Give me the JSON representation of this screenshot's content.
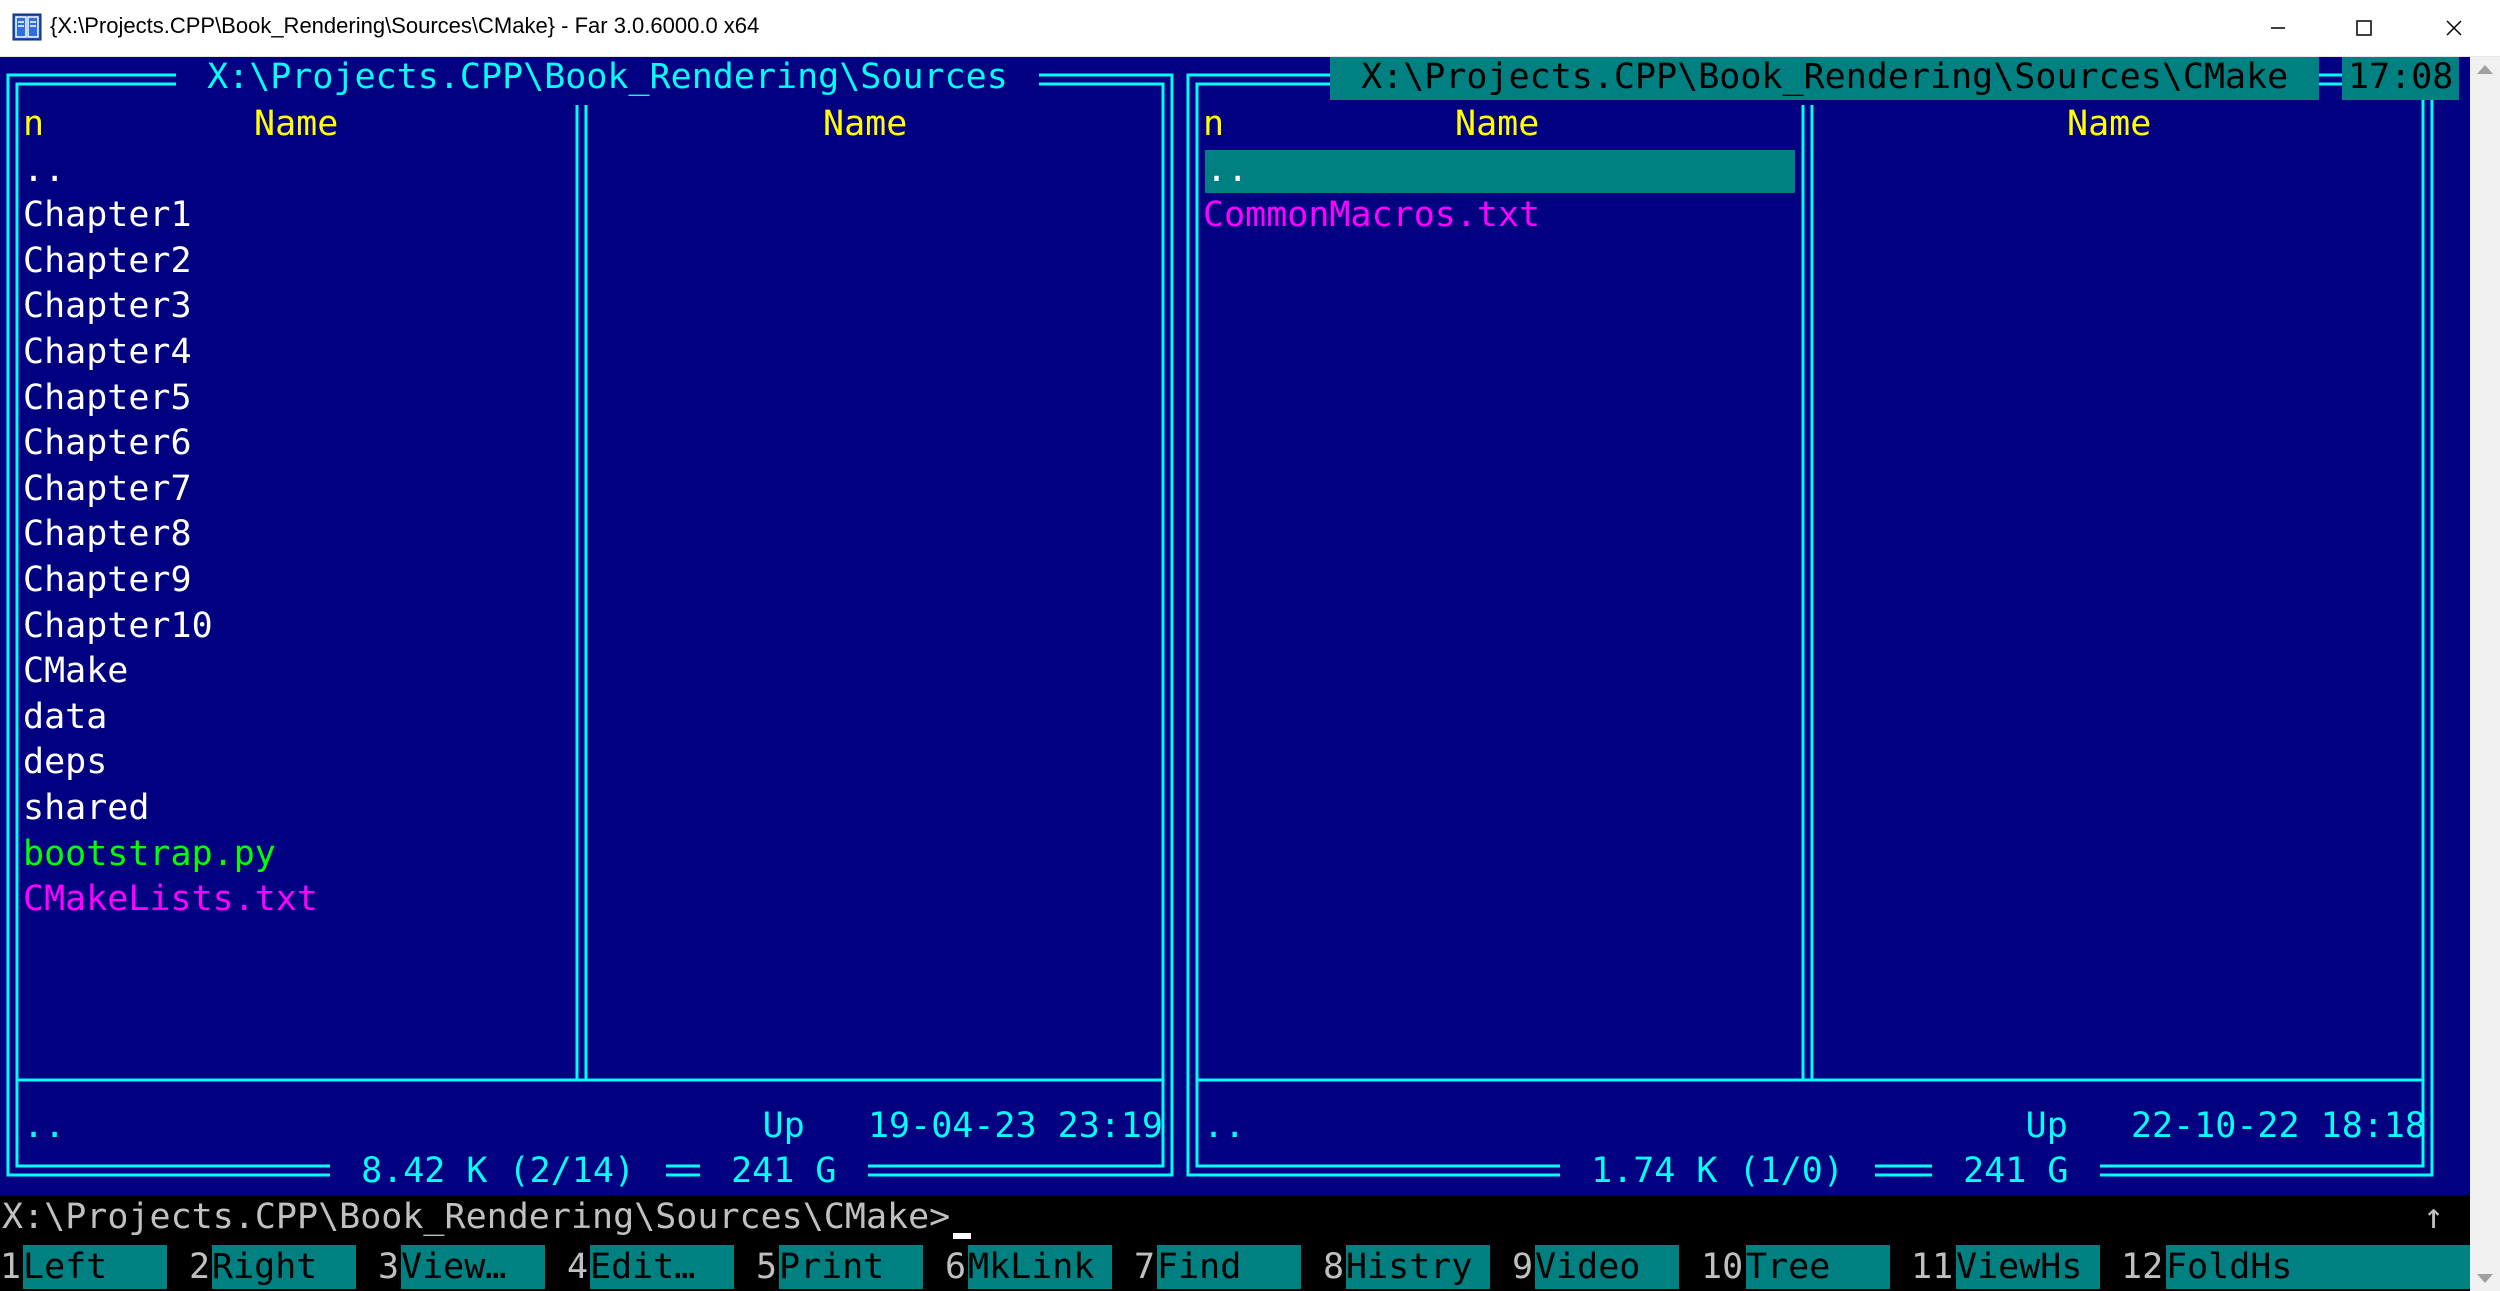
{
  "window": {
    "title": "{X:\\Projects.CPP\\Book_Rendering\\Sources\\CMake} - Far 3.0.6000.0 x64",
    "icon": "far-manager-icon"
  },
  "left_panel": {
    "path": " X:\\Projects.CPP\\Book_Rendering\\Sources ",
    "col_n": "n",
    "col_name_1": "Name",
    "col_name_2": "Name",
    "files": [
      {
        "name": "..",
        "color": "#ffffff"
      },
      {
        "name": "Chapter1",
        "color": "#ffffff"
      },
      {
        "name": "Chapter2",
        "color": "#ffffff"
      },
      {
        "name": "Chapter3",
        "color": "#ffffff"
      },
      {
        "name": "Chapter4",
        "color": "#ffffff"
      },
      {
        "name": "Chapter5",
        "color": "#ffffff"
      },
      {
        "name": "Chapter6",
        "color": "#ffffff"
      },
      {
        "name": "Chapter7",
        "color": "#ffffff"
      },
      {
        "name": "Chapter8",
        "color": "#ffffff"
      },
      {
        "name": "Chapter9",
        "color": "#ffffff"
      },
      {
        "name": "Chapter10",
        "color": "#ffffff"
      },
      {
        "name": "CMake",
        "color": "#ffffff"
      },
      {
        "name": "data",
        "color": "#ffffff"
      },
      {
        "name": "deps",
        "color": "#ffffff"
      },
      {
        "name": "shared",
        "color": "#ffffff"
      },
      {
        "name": "bootstrap.py",
        "color": "#00ff00"
      },
      {
        "name": "CMakeLists.txt",
        "color": "#ff00ff"
      }
    ],
    "status_name": "..",
    "status_info": "Up   19-04-23 23:19",
    "summary": " 8.42 K (2/14) ",
    "free": " 241 G "
  },
  "right_panel": {
    "path": " X:\\Projects.CPP\\Book_Rendering\\Sources\\CMake ",
    "clock": "17:08",
    "col_n": "n",
    "col_name_1": "Name",
    "col_name_2": "Name",
    "files": [
      {
        "name": "..",
        "color": "#ffffff",
        "selected": true
      },
      {
        "name": "CommonMacros.txt",
        "color": "#ff00ff"
      }
    ],
    "status_name": "..",
    "status_info": "Up   22-10-22 18:18",
    "summary": " 1.74 K (1/0) ",
    "free": " 241 G "
  },
  "command_line": {
    "prompt": "X:\\Projects.CPP\\Book_Rendering\\Sources\\CMake>",
    "scroll_indicator": "↑"
  },
  "keybar": [
    {
      "num": "1",
      "label": "Left"
    },
    {
      "num": "2",
      "label": "Right"
    },
    {
      "num": "3",
      "label": "View…"
    },
    {
      "num": "4",
      "label": "Edit…"
    },
    {
      "num": "5",
      "label": "Print"
    },
    {
      "num": "6",
      "label": "MkLink"
    },
    {
      "num": "7",
      "label": "Find"
    },
    {
      "num": "8",
      "label": "Histry"
    },
    {
      "num": "9",
      "label": "Video"
    },
    {
      "num": "10",
      "label": "Tree"
    },
    {
      "num": "11",
      "label": "ViewHs"
    },
    {
      "num": "12",
      "label": "FoldHs"
    }
  ],
  "colors": {
    "panel_bg": "#000080",
    "frame": "#00ffff",
    "cursor": "#008080",
    "header": "#ffff00"
  }
}
